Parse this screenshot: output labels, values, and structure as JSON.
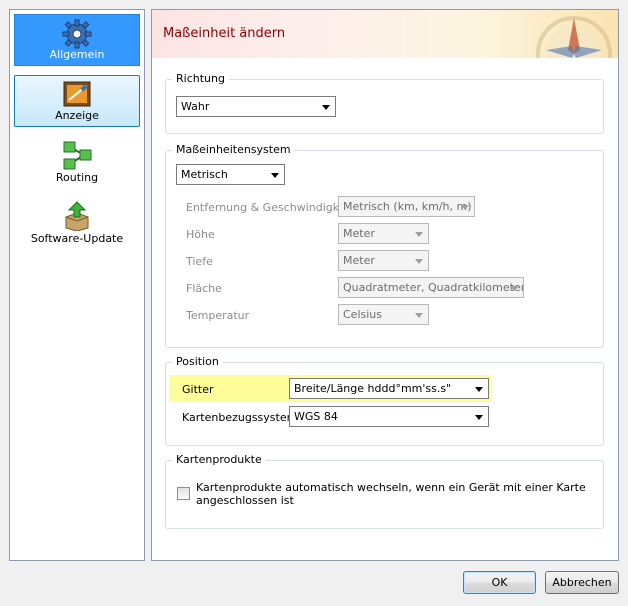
{
  "sidebar": {
    "items": [
      {
        "label": "Allgemein",
        "icon": "gear-icon"
      },
      {
        "label": "Anzeige",
        "icon": "display-settings-icon"
      },
      {
        "label": "Routing",
        "icon": "routing-icon"
      },
      {
        "label": "Software-Update",
        "icon": "software-update-icon"
      }
    ]
  },
  "header": {
    "title": "Maßeinheit ändern"
  },
  "richtung": {
    "title": "Richtung",
    "value": "Wahr"
  },
  "masseinheitensystem": {
    "title": "Maßeinheitensystem",
    "system_value": "Metrisch",
    "rows": [
      {
        "label": "Entfernung & Geschwindigkeit",
        "value": "Metrisch (km, km/h, m)"
      },
      {
        "label": "Höhe",
        "value": "Meter"
      },
      {
        "label": "Tiefe",
        "value": "Meter"
      },
      {
        "label": "Fläche",
        "value": "Quadratmeter, Quadratkilometer"
      },
      {
        "label": "Temperatur",
        "value": "Celsius"
      }
    ]
  },
  "position": {
    "title": "Position",
    "gitter_label": "Gitter",
    "gitter_value": "Breite/Länge hddd°mm'ss.s\"",
    "datum_label": "Kartenbezugssystem",
    "datum_value": "WGS 84"
  },
  "kartenprodukte": {
    "title": "Kartenprodukte",
    "checkbox_label_line1": "Kartenprodukte automatisch wechseln, wenn ein Gerät mit einer Karte",
    "checkbox_label_line2": "angeschlossen ist"
  },
  "buttons": {
    "ok": "OK",
    "cancel": "Abbrechen"
  },
  "colors": {
    "accent": "#3399ff",
    "title": "#8b0000",
    "highlight": "#fffd9a"
  }
}
